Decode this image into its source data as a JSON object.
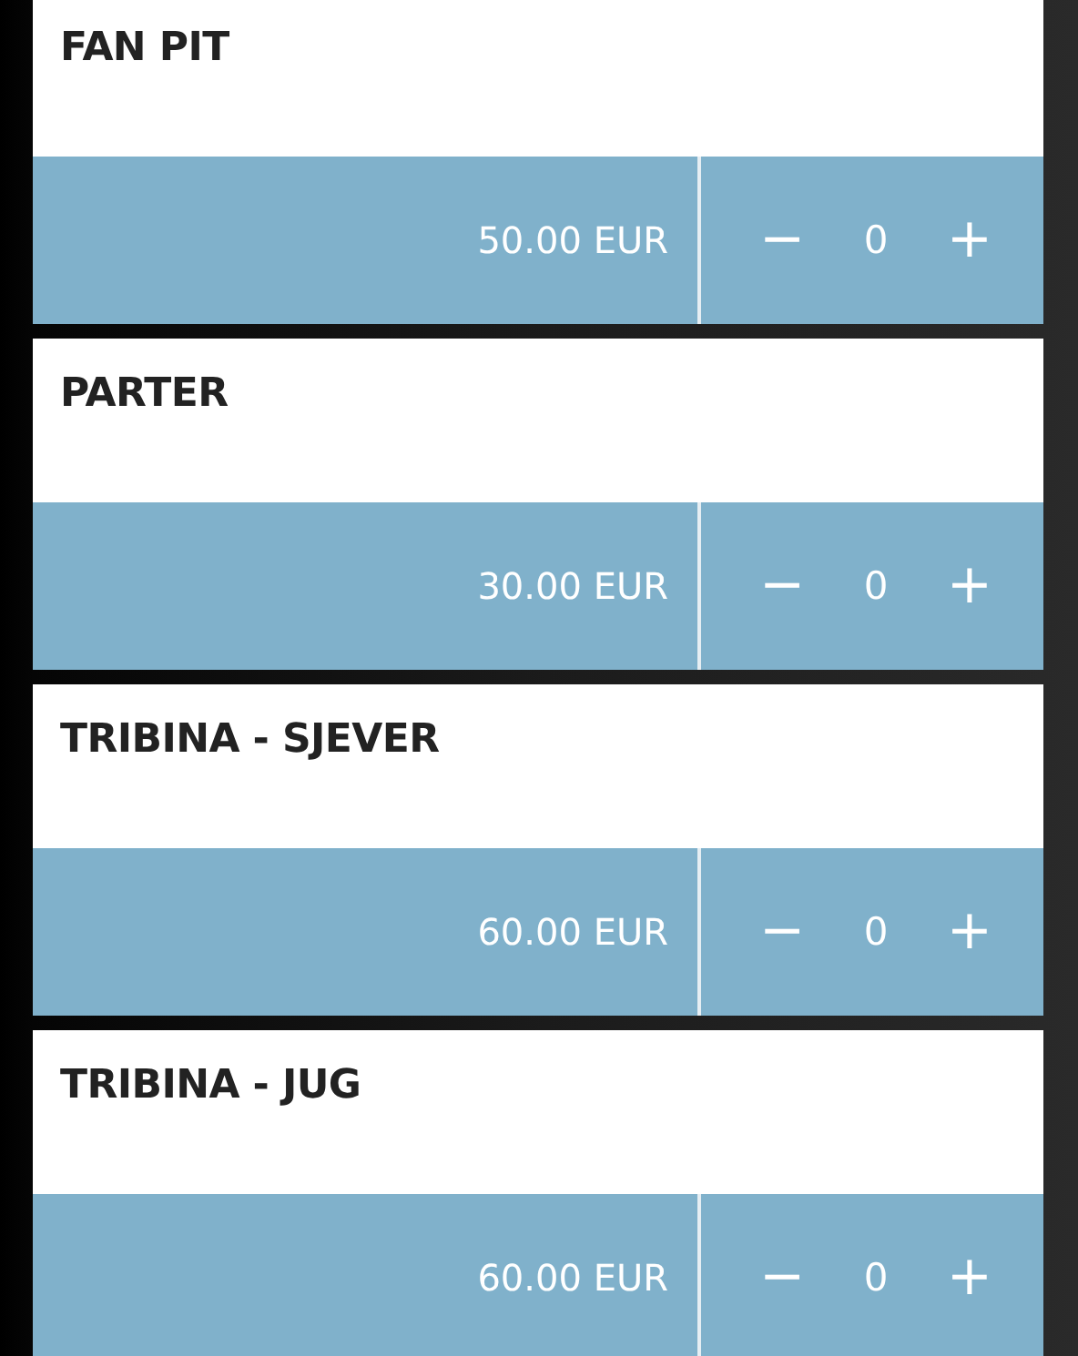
{
  "tickets": [
    {
      "name": "FAN PIT",
      "price": "50.00 EUR",
      "quantity": "0",
      "decrease": "−",
      "increase": "+"
    },
    {
      "name": "PARTER",
      "price": "30.00 EUR",
      "quantity": "0",
      "decrease": "−",
      "increase": "+"
    },
    {
      "name": "TRIBINA - SJEVER",
      "price": "60.00 EUR",
      "quantity": "0",
      "decrease": "−",
      "increase": "+"
    },
    {
      "name": "TRIBINA - JUG",
      "price": "60.00 EUR",
      "quantity": "0",
      "decrease": "−",
      "increase": "+"
    }
  ]
}
